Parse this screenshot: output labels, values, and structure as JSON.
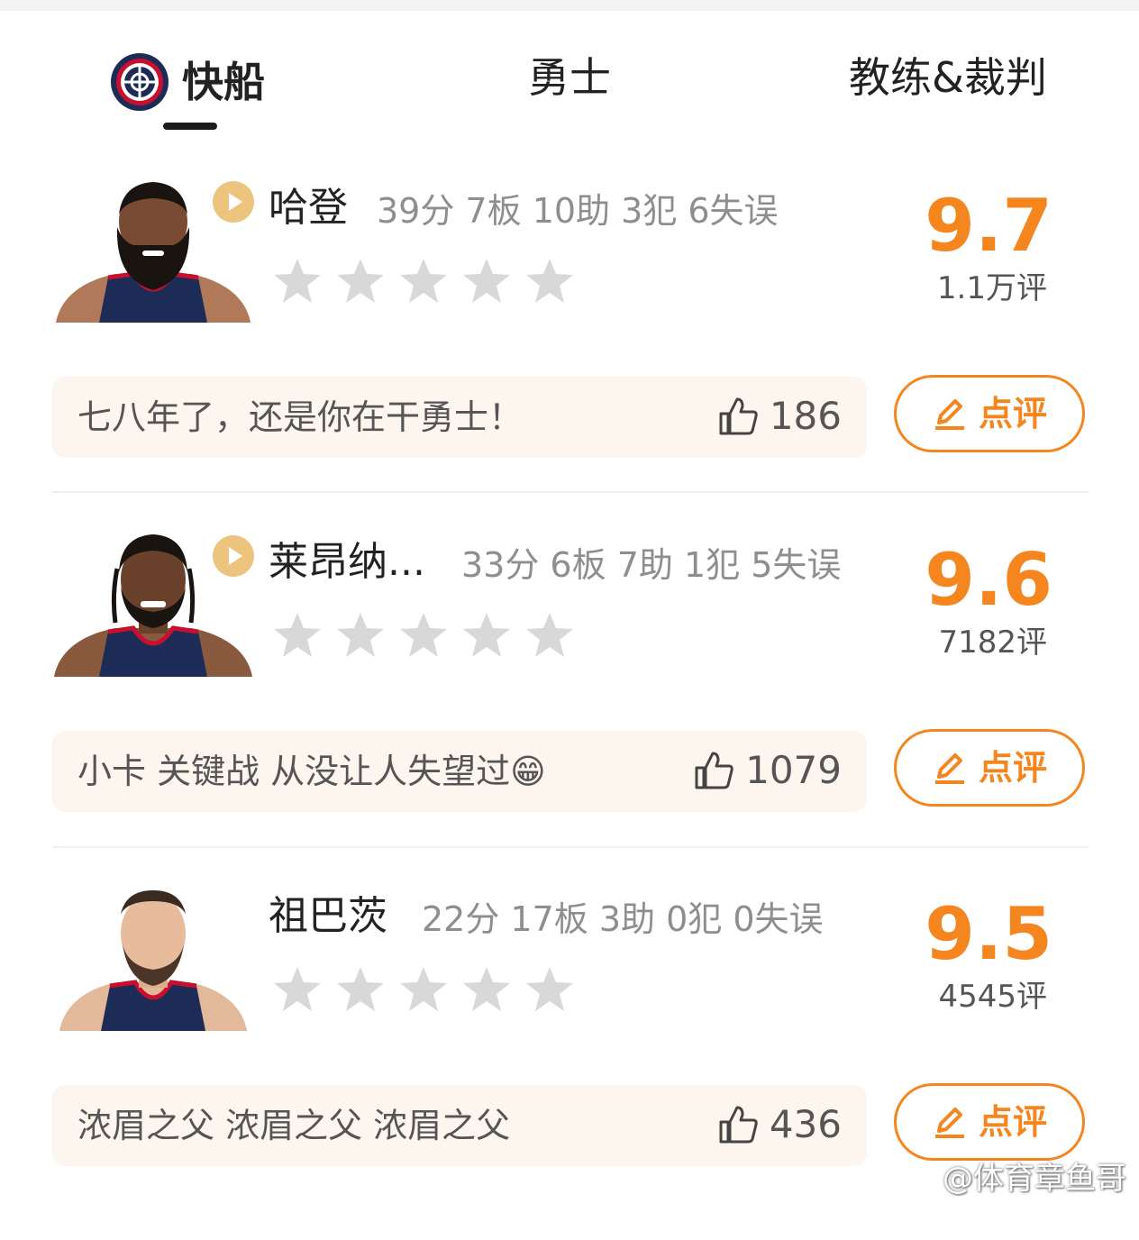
{
  "tabs": [
    {
      "label": "快船",
      "active": true
    },
    {
      "label": "勇士",
      "active": false
    },
    {
      "label": "教练&裁判",
      "active": false
    }
  ],
  "players": [
    {
      "name": "哈登",
      "stats": "39分 7板 10助 3犯 6失误",
      "score": "9.7",
      "rating_count": "1.1万评",
      "has_highlight_video": true,
      "stars": 5,
      "top_comment": "七八年了，还是你在干勇士！",
      "likes": "186",
      "review_label": "点评"
    },
    {
      "name": "莱昂纳...",
      "stats": "33分 6板 7助 1犯 5失误",
      "score": "9.6",
      "rating_count": "7182评",
      "has_highlight_video": true,
      "stars": 5,
      "top_comment": "小卡  关键战  从没让人失望过😁",
      "likes": "1079",
      "review_label": "点评"
    },
    {
      "name": "祖巴茨",
      "stats": "22分 17板 3助 0犯 0失误",
      "score": "9.5",
      "rating_count": "4545评",
      "has_highlight_video": false,
      "stars": 5,
      "top_comment": "浓眉之父 浓眉之父 浓眉之父",
      "likes": "436",
      "review_label": "点评"
    }
  ],
  "watermark": "@体育章鱼哥",
  "colors": {
    "accent": "#f5851f",
    "comment_bg": "#fdf6ee",
    "star": "#d8d8d8",
    "jersey": "#1d2b57"
  }
}
